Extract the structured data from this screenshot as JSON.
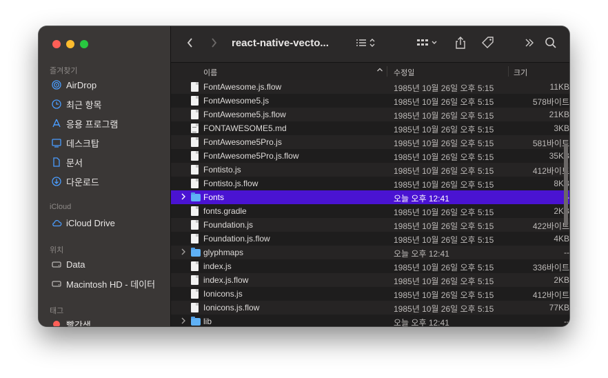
{
  "sidebar": {
    "sections": {
      "favorites": "즐겨찾기",
      "icloud": "iCloud",
      "locations": "위치",
      "tags": "태그"
    },
    "items": [
      {
        "label": "AirDrop",
        "icon": "airdrop-icon"
      },
      {
        "label": "최근 항목",
        "icon": "clock-icon"
      },
      {
        "label": "응용 프로그램",
        "icon": "applications-icon"
      },
      {
        "label": "데스크탑",
        "icon": "desktop-icon"
      },
      {
        "label": "문서",
        "icon": "document-icon"
      },
      {
        "label": "다운로드",
        "icon": "download-icon"
      },
      {
        "label": "iCloud Drive",
        "icon": "cloud-icon"
      },
      {
        "label": "Data",
        "icon": "disk-icon"
      },
      {
        "label": "Macintosh HD - 데이터",
        "icon": "disk-icon"
      },
      {
        "label": "빨간색",
        "icon": "red-tag-icon"
      }
    ]
  },
  "toolbar": {
    "title": "react-native-vecto...",
    "back_icon": "chevron-left-icon",
    "forward_icon": "chevron-right-icon"
  },
  "columns": {
    "name": "이름",
    "modified": "수정일",
    "size": "크기"
  },
  "files": [
    {
      "name": "FontAwesome.js.flow",
      "date": "1985년 10월 26일 오후 5:15",
      "size": "11KB",
      "kind": "doc"
    },
    {
      "name": "FontAwesome5.js",
      "date": "1985년 10월 26일 오후 5:15",
      "size": "578바이트",
      "kind": "doc"
    },
    {
      "name": "FontAwesome5.js.flow",
      "date": "1985년 10월 26일 오후 5:15",
      "size": "21KB",
      "kind": "doc"
    },
    {
      "name": "FONTAWESOME5.md",
      "date": "1985년 10월 26일 오후 5:15",
      "size": "3KB",
      "kind": "md"
    },
    {
      "name": "FontAwesome5Pro.js",
      "date": "1985년 10월 26일 오후 5:15",
      "size": "581바이트",
      "kind": "doc"
    },
    {
      "name": "FontAwesome5Pro.js.flow",
      "date": "1985년 10월 26일 오후 5:15",
      "size": "35KB",
      "kind": "doc"
    },
    {
      "name": "Fontisto.js",
      "date": "1985년 10월 26일 오후 5:15",
      "size": "412바이트",
      "kind": "doc"
    },
    {
      "name": "Fontisto.js.flow",
      "date": "1985년 10월 26일 오후 5:15",
      "size": "8KB",
      "kind": "doc"
    },
    {
      "name": "Fonts",
      "date": "오늘 오후 12:41",
      "size": "--",
      "kind": "folder",
      "selected": true
    },
    {
      "name": "fonts.gradle",
      "date": "1985년 10월 26일 오후 5:15",
      "size": "2KB",
      "kind": "doc"
    },
    {
      "name": "Foundation.js",
      "date": "1985년 10월 26일 오후 5:15",
      "size": "422바이트",
      "kind": "doc"
    },
    {
      "name": "Foundation.js.flow",
      "date": "1985년 10월 26일 오후 5:15",
      "size": "4KB",
      "kind": "doc"
    },
    {
      "name": "glyphmaps",
      "date": "오늘 오후 12:41",
      "size": "--",
      "kind": "folder"
    },
    {
      "name": "index.js",
      "date": "1985년 10월 26일 오후 5:15",
      "size": "336바이트",
      "kind": "doc"
    },
    {
      "name": "index.js.flow",
      "date": "1985년 10월 26일 오후 5:15",
      "size": "2KB",
      "kind": "doc"
    },
    {
      "name": "Ionicons.js",
      "date": "1985년 10월 26일 오후 5:15",
      "size": "412바이트",
      "kind": "doc"
    },
    {
      "name": "Ionicons.js.flow",
      "date": "1985년 10월 26일 오후 5:15",
      "size": "77KB",
      "kind": "doc"
    },
    {
      "name": "lib",
      "date": "오늘 오후 12:41",
      "size": "--",
      "kind": "folder"
    }
  ]
}
